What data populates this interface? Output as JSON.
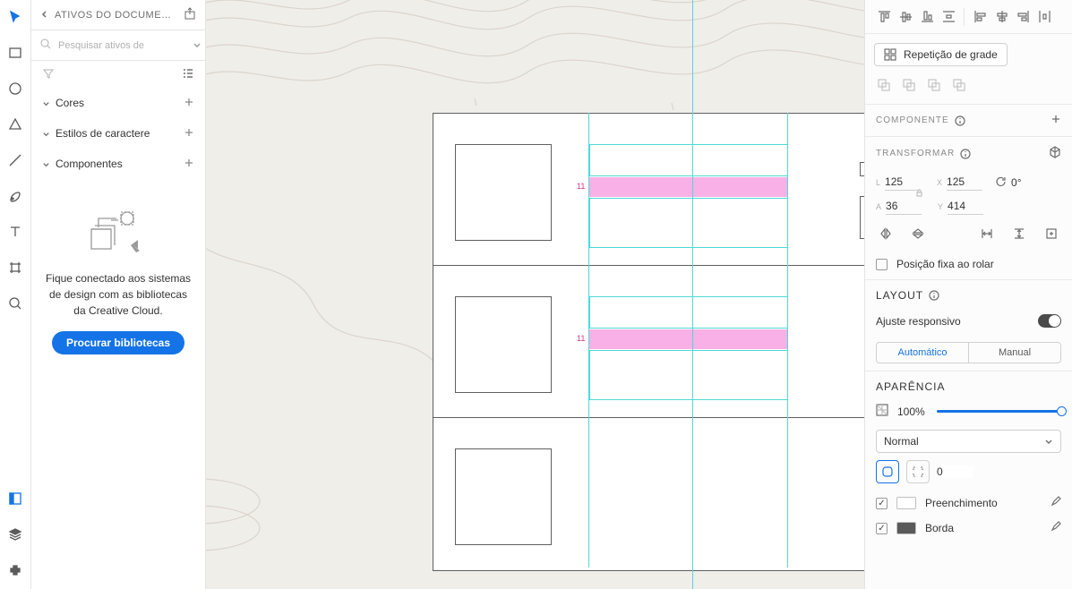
{
  "left_panel": {
    "title": "ATIVOS DO DOCUMENT…",
    "search_placeholder": "Pesquisar ativos de",
    "sections": {
      "colors": "Cores",
      "char_styles": "Estilos de caractere",
      "components": "Componentes"
    },
    "promo_text": "Fique conectado aos sistemas de design com as bibliotecas da Creative Cloud.",
    "promo_button": "Procurar bibliotecas"
  },
  "canvas": {
    "gap_value": "11"
  },
  "right_panel": {
    "repeat_grid": "Repetição de grade",
    "component_section": "COMPONENTE",
    "transform_section": "TRANSFORMAR",
    "w": "125",
    "x": "125",
    "h": "36",
    "y": "414",
    "rotation": "0°",
    "fixed_scroll": "Posição fixa ao rolar",
    "layout_section": "LAYOUT",
    "responsive_label": "Ajuste responsivo",
    "seg_auto": "Automático",
    "seg_manual": "Manual",
    "appearance_section": "APARÊNCIA",
    "opacity": "100%",
    "blend_mode": "Normal",
    "corner_radius": "0",
    "fill_label": "Preenchimento",
    "border_label": "Borda"
  }
}
